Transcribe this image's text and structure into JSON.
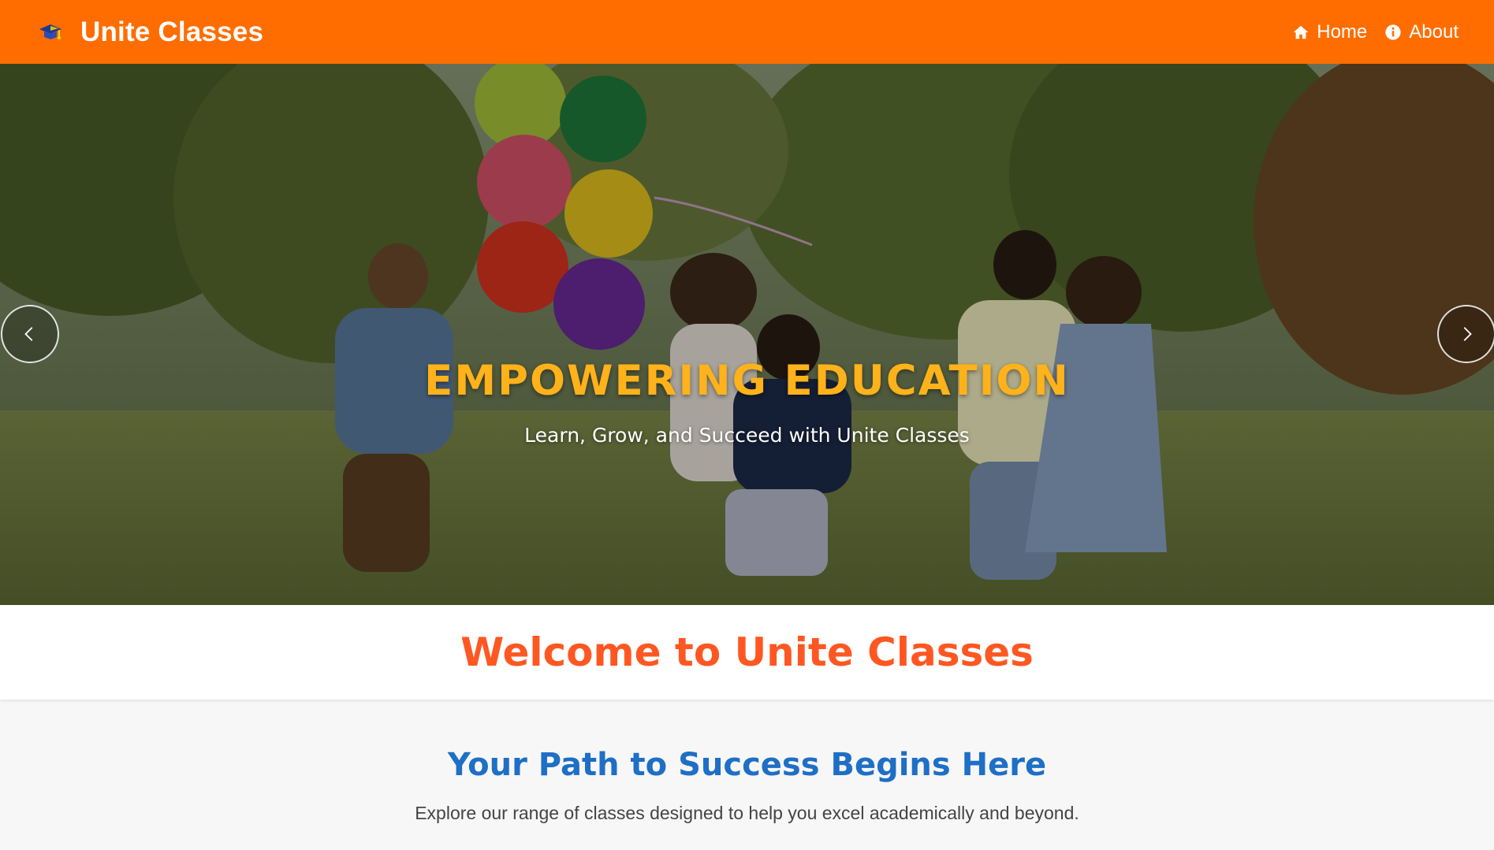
{
  "navbar": {
    "brand": {
      "icon": "graduation-cap-icon",
      "name": "Unite Classes"
    },
    "links": [
      {
        "icon": "home-icon",
        "label": "Home"
      },
      {
        "icon": "info-circle-icon",
        "label": "About"
      }
    ],
    "color": "#ff6d00"
  },
  "hero": {
    "image": "children-running-with-balloons-in-park",
    "title": "EMPOWERING EDUCATION",
    "subtitle": "Learn, Grow, and Succeed with Unite Classes",
    "controls": {
      "prev_icon": "chevron-left-icon",
      "next_icon": "chevron-right-icon"
    },
    "title_color": "#ffb21a"
  },
  "welcome": {
    "title": "Welcome to Unite Classes",
    "color": "#ff5722"
  },
  "intro": {
    "title": "Your Path to Success Begins Here",
    "text": "Explore our range of classes designed to help you excel academically and beyond.",
    "title_color": "#1e6fc5"
  }
}
